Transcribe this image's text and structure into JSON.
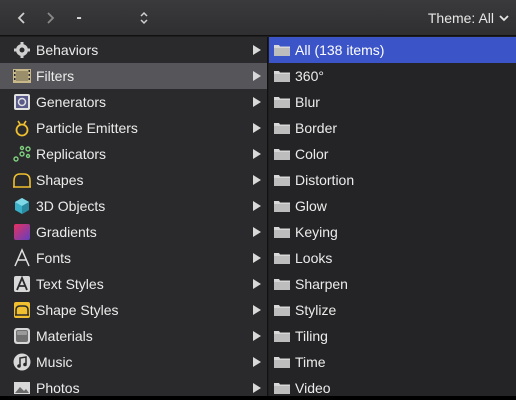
{
  "toolbar": {
    "back_icon": "chevron-left-icon",
    "forward_icon": "chevron-right-icon",
    "dash": "-",
    "stepper_icon": "up-down-chevron-icon",
    "theme_label": "Theme: All",
    "theme_chevron": "chevron-down-icon"
  },
  "left_items": [
    {
      "label": "Behaviors",
      "icon": "gear-icon"
    },
    {
      "label": "Filters",
      "icon": "film-strip-icon"
    },
    {
      "label": "Generators",
      "icon": "generator-icon"
    },
    {
      "label": "Particle Emitters",
      "icon": "particle-emitter-icon"
    },
    {
      "label": "Replicators",
      "icon": "replicator-icon"
    },
    {
      "label": "Shapes",
      "icon": "shape-icon"
    },
    {
      "label": "3D Objects",
      "icon": "cube-icon"
    },
    {
      "label": "Gradients",
      "icon": "gradient-icon"
    },
    {
      "label": "Fonts",
      "icon": "font-icon"
    },
    {
      "label": "Text Styles",
      "icon": "text-style-icon"
    },
    {
      "label": "Shape Styles",
      "icon": "shape-style-icon"
    },
    {
      "label": "Materials",
      "icon": "material-icon"
    },
    {
      "label": "Music",
      "icon": "music-icon"
    },
    {
      "label": "Photos",
      "icon": "photo-icon"
    }
  ],
  "right_items": [
    {
      "label": "All (138 items)"
    },
    {
      "label": "360°"
    },
    {
      "label": "Blur"
    },
    {
      "label": "Border"
    },
    {
      "label": "Color"
    },
    {
      "label": "Distortion"
    },
    {
      "label": "Glow"
    },
    {
      "label": "Keying"
    },
    {
      "label": "Looks"
    },
    {
      "label": "Sharpen"
    },
    {
      "label": "Stylize"
    },
    {
      "label": "Tiling"
    },
    {
      "label": "Time"
    },
    {
      "label": "Video"
    }
  ],
  "colors": {
    "selection_left": "#56565a",
    "selection_right": "#3b55c9",
    "panel_left": "#2a2a2c",
    "panel_right": "#242426"
  }
}
